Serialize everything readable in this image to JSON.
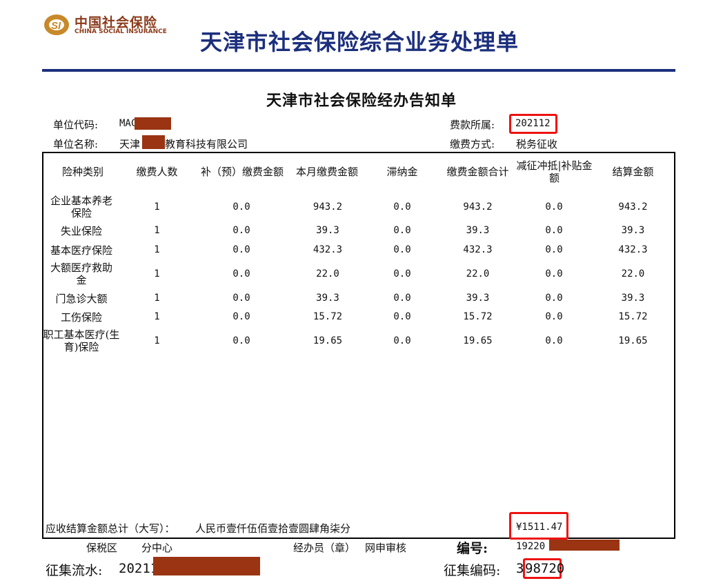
{
  "logo": {
    "cn": "中国社会保险",
    "en": "CHINA SOCIAL INSURANCE"
  },
  "title": "天津市社会保险综合业务处理单",
  "subtitle": "天津市社会保险经办告知单",
  "info": {
    "unit_code_label": "单位代码:",
    "unit_code_value": "MAC",
    "fee_period_label": "费款所属:",
    "fee_period_value": "202112",
    "unit_name_label": "单位名称:",
    "unit_name_prefix": "天津",
    "unit_name_suffix": "教育科技有限公司",
    "payment_method_label": "缴费方式:",
    "payment_method_value": "税务征收"
  },
  "table": {
    "headers": [
      "险种类别",
      "缴费人数",
      "补（预）缴费金额",
      "本月缴费金额",
      "滞纳金",
      "缴费金额合计",
      "减征冲抵|补贴金额",
      "结算金额"
    ],
    "rows": [
      {
        "type": "企业基本养老保险",
        "count": "1",
        "supplement": "0.0",
        "monthly": "943.2",
        "late_fee": "0.0",
        "total": "943.2",
        "deduction": "0.0",
        "settlement": "943.2"
      },
      {
        "type": "失业保险",
        "count": "1",
        "supplement": "0.0",
        "monthly": "39.3",
        "late_fee": "0.0",
        "total": "39.3",
        "deduction": "0.0",
        "settlement": "39.3"
      },
      {
        "type": "基本医疗保险",
        "count": "1",
        "supplement": "0.0",
        "monthly": "432.3",
        "late_fee": "0.0",
        "total": "432.3",
        "deduction": "0.0",
        "settlement": "432.3"
      },
      {
        "type": "大额医疗救助金",
        "count": "1",
        "supplement": "0.0",
        "monthly": "22.0",
        "late_fee": "0.0",
        "total": "22.0",
        "deduction": "0.0",
        "settlement": "22.0"
      },
      {
        "type": "门急诊大额",
        "count": "1",
        "supplement": "0.0",
        "monthly": "39.3",
        "late_fee": "0.0",
        "total": "39.3",
        "deduction": "0.0",
        "settlement": "39.3"
      },
      {
        "type": "工伤保险",
        "count": "1",
        "supplement": "0.0",
        "monthly": "15.72",
        "late_fee": "0.0",
        "total": "15.72",
        "deduction": "0.0",
        "settlement": "15.72"
      },
      {
        "type": "职工基本医疗(生育)保险",
        "count": "1",
        "supplement": "0.0",
        "monthly": "19.65",
        "late_fee": "0.0",
        "total": "19.65",
        "deduction": "0.0",
        "settlement": "19.65"
      }
    ]
  },
  "summary": {
    "label": "应收结算金额总计（大写）：",
    "value_words": "人民币壹仟伍佰壹拾壹圆肆角柒分",
    "value_amount": "¥1511.47"
  },
  "footer": {
    "district_label": "保税区",
    "district_value": "分中心",
    "handler_label": "经办员（章）",
    "handler_value": "网申审核",
    "number_label": "编号:",
    "number_value": "19220",
    "serial_label": "征集流水:",
    "serial_value": "20211",
    "code_label": "征集编码:",
    "code_prefix": "3",
    "code_boxed": "98720"
  }
}
